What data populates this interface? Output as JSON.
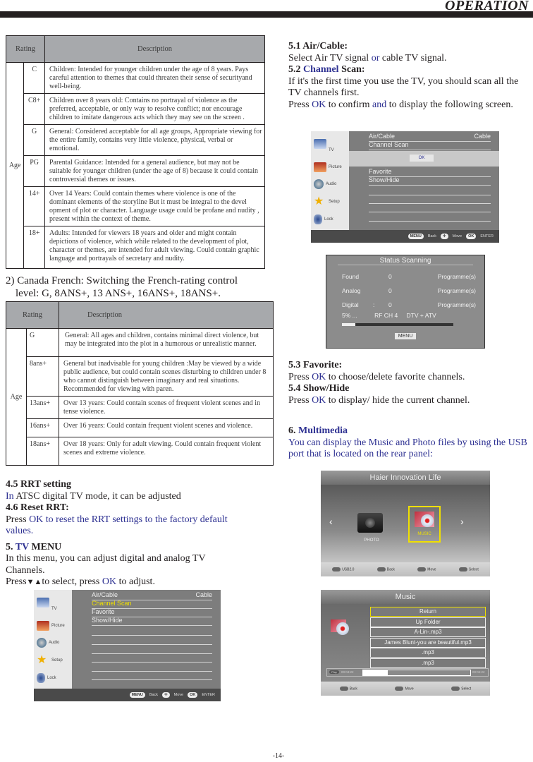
{
  "header": {
    "title": "OPERATION"
  },
  "table1": {
    "col_rating": "Rating",
    "col_description": "Description",
    "group_label": "Age",
    "rows": [
      {
        "code": "C",
        "desc": "Children: Intended for younger children under the age of 8 years. Pays careful attention to themes that could threaten their sense of securityand well-being."
      },
      {
        "code": "C8+",
        "desc": "Children over 8 years old: Contains no portrayal of violence as the preferred, acceptable, or only way to resolve conflict; nor encourage children to imitate dangerous acts which they may see on the screen ."
      },
      {
        "code": "G",
        "desc": "General: Considered acceptable for all age groups, Appropriate viewing for the entire family, contains very little violence, physical, verbal or emotional."
      },
      {
        "code": "PG",
        "desc": "Parental Guidance: Intended for a general audience, but may not be suitable for younger children (under the age of 8) because it could contain controversial themes or issues."
      },
      {
        "code": "14+",
        "desc": "Over 14 Years: Could contain themes where violence is one of the dominant elements of the storyline But it must be integral to the devel opment of plot or character. Language usage could be profane and nudity , present within the context of theme."
      },
      {
        "code": "18+",
        "desc": "Adults: Intended for viewers 18 years and older and might contain depictions of  violence, which while related to the development of plot,  character or themes, are intended for adult  viewing. Could contain graphic language and portrayals of secretary and nudity."
      }
    ]
  },
  "canada_french": {
    "line1": "2) Canada French: Switching the French-rating control",
    "line2": "level: G, 8ANS+, 13 ANS+, 16ANS+, 18ANS+."
  },
  "table2": {
    "col_rating": "Rating",
    "col_description": "Description",
    "group_label": "Age",
    "rows": [
      {
        "code": "G",
        "desc": "General: All ages and children, contains minimal direct violence, but may be integrated into the plot in a humorous or unrealistic manner."
      },
      {
        "code": "8ans+",
        "desc": "General but inadvisable for young children :May be viewed by a wide public audience, but could contain scenes disturbing to children under 8 who cannot distinguish between imaginary and real situations. Recommended for viewing with paren."
      },
      {
        "code": "13ans+",
        "desc": "Over 13 years: Could contain scenes of frequent violent scenes and in tense violence."
      },
      {
        "code": "16ans+",
        "desc": "Over 16 years: Could contain frequent violent scenes and violence."
      },
      {
        "code": "18ans+",
        "desc": "Over 18 years: Only for adult viewing. Could contain frequent violent  scenes and extreme violence."
      }
    ]
  },
  "left_text": {
    "s45_title": "4.5 RRT setting",
    "s45_in": "In",
    "s45_rest": " ATSC digital TV mode, it can be adjusted",
    "s46_title": "4.6 Reset RRT:",
    "s46_press": "Press ",
    "s46_blue": "OK to reset the RRT settings to the factory default values.",
    "s5_num": "5. ",
    "s5_tv": "TV",
    "s5_menu": " MENU",
    "s5_body": "In this menu, you can adjust digital and analog TV Channels.",
    "s5_press": "Press",
    "s5_arrows": "▼▲",
    "s5_to": "to select, press ",
    "s5_ok": "OK",
    "s5_adjust": " to adjust."
  },
  "tv_menu": {
    "sidebar": [
      "TV",
      "Picture",
      "Audio",
      "Setup",
      "Lock"
    ],
    "rows": [
      {
        "label": "Air/Cable",
        "value": "Cable"
      },
      {
        "label": "Channel Scan",
        "value": ""
      },
      {
        "label": "Favorite",
        "value": ""
      },
      {
        "label": "Show/Hide",
        "value": ""
      }
    ],
    "highlight_color": "#f0e000",
    "footer": {
      "menu": "MENU",
      "back": "Back",
      "move": "Move",
      "ok": "OK",
      "enter": "ENTER"
    },
    "ok_button": "OK"
  },
  "right_text": {
    "s51_title": "5.1 Air/Cable:",
    "s51_a": "Select Air TV signal ",
    "s51_or": "or",
    "s51_b": " cable TV signal.",
    "s52_num": "5.2 ",
    "s52_channel": "Channel",
    "s52_scan": " Scan:",
    "s52_body": "If it's the first time you use the TV, you should scan all the TV channels first.",
    "s52_press": "Press ",
    "s52_ok": "OK",
    "s52_confirm": " to confirm ",
    "s52_and": "and",
    "s52_rest": " to display the following screen.",
    "s53_title": "5.3 Favorite:",
    "s53_press": "Press ",
    "s53_ok": "OK",
    "s53_rest": " to choose/delete  favorite channels.",
    "s54_title": "5.4 Show/Hide",
    "s54_press": "Press ",
    "s54_ok": "OK",
    "s54_rest": " to display/ hide the current channel.",
    "s6_num": "6. ",
    "s6_title": "Multimedia",
    "s6_body": "You can display the Music and Photo files by using the USB port that is located on the rear panel:"
  },
  "scan_status": {
    "title": "Status Scanning",
    "rows": [
      {
        "label": "Found",
        "sep": "",
        "count": "0",
        "unit": "Programme(s)"
      },
      {
        "label": "Analog",
        "sep": "",
        "count": "0",
        "unit": "Programme(s)"
      },
      {
        "label": "Digital",
        "sep": ":",
        "count": "0",
        "unit": "Programme(s)"
      }
    ],
    "progress_text": "5% ...",
    "rf": "RF CH 4",
    "mode": "DTV + ATV",
    "progress": 0.05,
    "menu_button": "MENU"
  },
  "multimedia_home": {
    "title": "Haier Innovation Life",
    "items": [
      "PHOTO",
      "MUSIC"
    ],
    "selected": "MUSIC",
    "prev": "‹",
    "next": "›",
    "footer": [
      "USB2.0",
      "Back",
      "Move",
      "Select"
    ]
  },
  "music_browser": {
    "title": "Music",
    "files": [
      "Return",
      "Up Folder",
      "A-Lin-.mp3",
      "James Blunt-you are beautiful.mp3",
      ".mp3",
      ".mp3"
    ],
    "selected_index": 0,
    "play_label": "Play",
    "time_elapsed": "00:04:22",
    "time_total": "00:04:22",
    "progress": 0.23,
    "footer": [
      "Back",
      "Move",
      "Select"
    ]
  },
  "page_number": "-14-"
}
